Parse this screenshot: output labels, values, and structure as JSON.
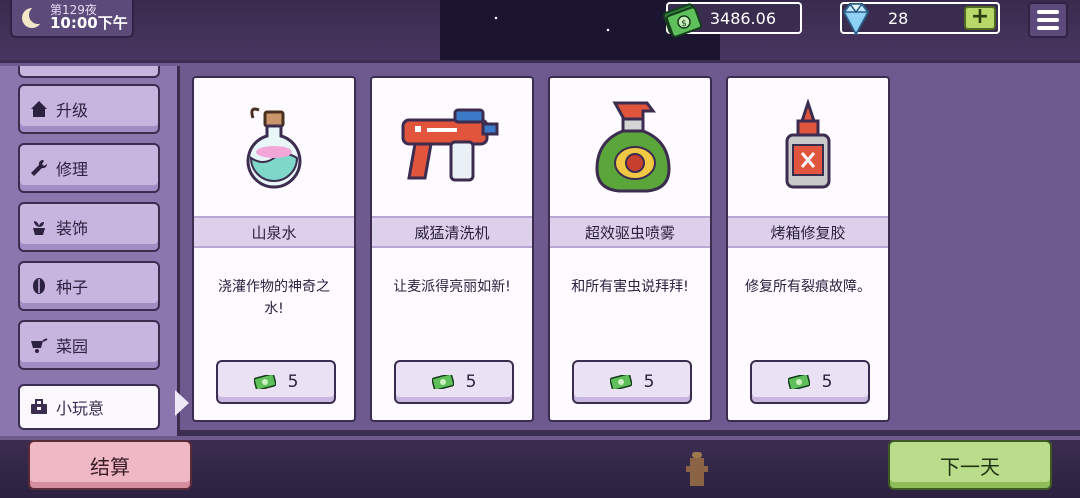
{
  "hud": {
    "night_label": "第129夜",
    "clock": "10:00下午",
    "money": "3486.06",
    "gems": "28",
    "plus_label": "+"
  },
  "sidebar": {
    "items": [
      {
        "label": "升级",
        "icon": "house-icon"
      },
      {
        "label": "修理",
        "icon": "wrench-icon"
      },
      {
        "label": "装饰",
        "icon": "plant-pot-icon"
      },
      {
        "label": "种子",
        "icon": "seed-icon"
      },
      {
        "label": "菜园",
        "icon": "wheelbarrow-icon"
      },
      {
        "label": "小玩意",
        "icon": "toolbox-icon",
        "active": true
      }
    ]
  },
  "cards": [
    {
      "name": "山泉水",
      "desc": "浇灌作物的神奇之水!",
      "price": "5",
      "icon": "potion-flask-icon"
    },
    {
      "name": "威猛清洗机",
      "desc": "让麦派得亮丽如新!",
      "price": "5",
      "icon": "pressure-washer-icon"
    },
    {
      "name": "超效驱虫喷雾",
      "desc": "和所有害虫说拜拜!",
      "price": "5",
      "icon": "bug-spray-icon"
    },
    {
      "name": "烤箱修复胶",
      "desc": "修复所有裂痕故障。",
      "price": "5",
      "icon": "glue-bottle-icon"
    }
  ],
  "footer": {
    "checkout_label": "结算",
    "next_day_label": "下一天"
  },
  "colors": {
    "panel": "#6e5a8f",
    "card_bg": "#fdfbff",
    "checkout": "#efb8c4",
    "next_day": "#b9dd8a"
  }
}
